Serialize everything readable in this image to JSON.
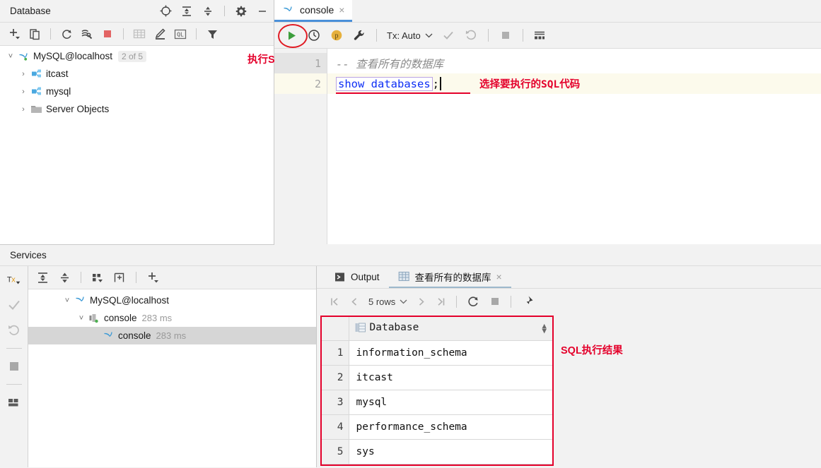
{
  "database_panel": {
    "title": "Database",
    "header_icons": [
      "locate-icon",
      "expand-all-icon",
      "collapse-all-icon",
      "gear-icon",
      "minimize-icon"
    ],
    "toolbar_icons": [
      "add-icon",
      "copy-icon",
      "refresh-icon",
      "sync-tool-icon",
      "stop-icon",
      "table-icon",
      "edit-icon",
      "query-console-icon",
      "filter-icon"
    ],
    "tree": [
      {
        "label": "MySQL@localhost",
        "badge": "2 of 5",
        "icon": "mysql-dolphin-icon",
        "level": 0,
        "expanded": true
      },
      {
        "label": "itcast",
        "badge": "",
        "icon": "schema-icon",
        "level": 1,
        "expanded": false
      },
      {
        "label": "mysql",
        "badge": "",
        "icon": "schema-icon",
        "level": 1,
        "expanded": false
      },
      {
        "label": "Server Objects",
        "badge": "",
        "icon": "folder-icon",
        "level": 1,
        "expanded": false
      }
    ]
  },
  "editor": {
    "tab": {
      "label": "console",
      "icon": "mysql-dolphin-icon",
      "close": "×"
    },
    "toolbar": {
      "run_label": "run-icon",
      "history_label": "history-icon",
      "param_label": "p",
      "tools_label": "wrench-icon",
      "tx_label": "Tx: Auto",
      "commit_label": "commit-icon",
      "rollback_label": "rollback-icon",
      "stop_label": "stop-icon",
      "grid_label": "data-editor-icon"
    },
    "lines": [
      {
        "number": "1",
        "text": "--  查看所有的数据库",
        "type": "comment"
      },
      {
        "number": "2",
        "text": "show databases",
        "suffix": ";",
        "type": "sql",
        "status": "ok"
      }
    ]
  },
  "annotations": {
    "run_sql": "执行SQL",
    "select_sql": "选择要执行的SQL代码",
    "sql_result": "SQL执行结果",
    "accent_color": "#e4002b"
  },
  "services": {
    "title": "Services",
    "rail_icons": [
      "tx-icon",
      "commit-icon",
      "rollback-icon",
      "stop-icon",
      "layout-icon"
    ],
    "rail_tx_label": "Tx",
    "toolbar_icons": [
      "expand-all-icon",
      "collapse-all-icon",
      "group-icon",
      "add-frame-icon",
      "add-icon"
    ],
    "tree": [
      {
        "label": "MySQL@localhost",
        "time": "",
        "icon": "mysql-dolphin-icon",
        "level": 0,
        "expanded": true,
        "selected": false
      },
      {
        "label": "console",
        "time": "283 ms",
        "icon": "session-icon",
        "level": 1,
        "expanded": true,
        "selected": false
      },
      {
        "label": "console",
        "time": "283 ms",
        "icon": "mysql-dolphin-icon",
        "level": 2,
        "expanded": false,
        "selected": true
      }
    ]
  },
  "results": {
    "tabs": [
      {
        "label": "Output",
        "icon": "output-icon",
        "active": false,
        "closable": false
      },
      {
        "label": "查看所有的数据库",
        "icon": "table-icon",
        "active": true,
        "closable": true
      }
    ],
    "close_glyph": "×",
    "toolbar": {
      "first_page": "first-page-icon",
      "prev_page": "prev-page-icon",
      "rows_label": "5 rows",
      "next_page": "next-page-icon",
      "last_page": "last-page-icon",
      "reload": "reload-icon",
      "stop": "stop-icon",
      "pin": "pin-icon"
    },
    "grid": {
      "column_header": "Database",
      "header_icon": "column-icon",
      "rows": [
        {
          "num": "1",
          "value": "information_schema"
        },
        {
          "num": "2",
          "value": "itcast"
        },
        {
          "num": "3",
          "value": "mysql"
        },
        {
          "num": "4",
          "value": "performance_schema"
        },
        {
          "num": "5",
          "value": "sys"
        }
      ]
    }
  }
}
